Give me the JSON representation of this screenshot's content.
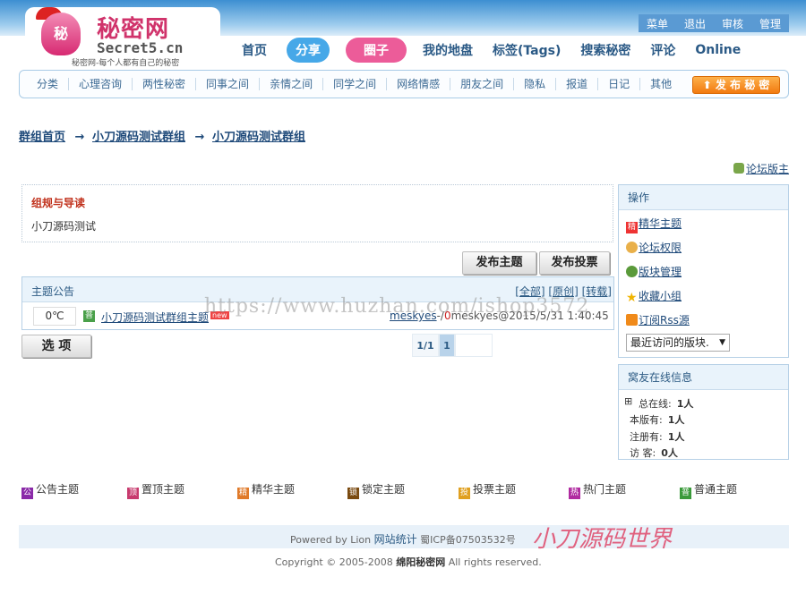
{
  "header": {
    "logo": {
      "badge": "秘",
      "name": "秘密网",
      "domain": "Secret5.cn",
      "slogan": "秘密网-每个人都有自己的秘密"
    },
    "util_links": [
      "菜单",
      "退出",
      "审核",
      "管理"
    ],
    "main_nav": [
      "首页",
      "分享",
      "圈子",
      "我的地盘",
      "标签(Tags)",
      "搜索秘密",
      "评论",
      "Online"
    ],
    "categories": [
      "分类",
      "心理咨询",
      "两性秘密",
      "同事之间",
      "亲情之间",
      "同学之间",
      "网络情感",
      "朋友之间",
      "隐私",
      "报道",
      "日记",
      "其他"
    ],
    "post_secret_label": "发 布 秘 密"
  },
  "breadcrumb": {
    "items": [
      "群组首页",
      "小刀源码测试群组",
      "小刀源码测试群组"
    ],
    "separator": "→"
  },
  "moderator_link": "论坛版主",
  "rules": {
    "title": "组规与导读",
    "body": "小刀源码测试"
  },
  "actions": {
    "new_topic": "发布主题",
    "new_poll": "发布投票",
    "options": "选 项"
  },
  "announcement": {
    "title": "主题公告",
    "links": [
      "[全部]",
      "[原创]",
      "[转载]"
    ],
    "row": {
      "temperature": "0℃",
      "type_badge": "普",
      "subject": "小刀源码测试群组主题",
      "new_badge": "new",
      "author": "meskyes",
      "separator": "-/",
      "last_reply": "0",
      "last_info": "meskyes@2015/5/31 1:40:45"
    }
  },
  "pager": {
    "summary": "1/1",
    "current": "1"
  },
  "watermark": "https://www.huzhan.com/ishop3572",
  "sidebar": {
    "ops_title": "操作",
    "ops": [
      {
        "icon": "精",
        "label": "精华主题"
      },
      {
        "icon": "",
        "label": "论坛权限"
      },
      {
        "icon": "",
        "label": "版块管理"
      },
      {
        "icon": "",
        "label": "收藏小组"
      },
      {
        "icon": "",
        "label": "订阅Rss源"
      }
    ],
    "recent_select": "最近访问的版块.",
    "online_title": "窝友在线信息",
    "online": {
      "expand": "⊞",
      "total_label": "总在线:",
      "total_value": "1人",
      "here_label": "本版有:",
      "here_value": "1人",
      "registered_label": "注册有:",
      "registered_value": "1人",
      "guest_label": "访 客:",
      "guest_value": "0人"
    }
  },
  "legend": [
    {
      "icon": "公",
      "label": "公告主题",
      "color": "#8a2aa8"
    },
    {
      "icon": "顶",
      "label": "置顶主题",
      "color": "#c83a6e"
    },
    {
      "icon": "精",
      "label": "精华主题",
      "color": "#e07a2a"
    },
    {
      "icon": "锁",
      "label": "锁定主题",
      "color": "#7a4a10"
    },
    {
      "icon": "投",
      "label": "投票主题",
      "color": "#e0a020"
    },
    {
      "icon": "热",
      "label": "热门主题",
      "color": "#b02aa0"
    },
    {
      "icon": "普",
      "label": "普通主题",
      "color": "#3a9a3a"
    }
  ],
  "footer": {
    "powered": "Powered by Lion",
    "stat_link": "网站统计",
    "icp": "蜀ICP备07503532号",
    "signature": "小刀源码世界",
    "copyright_prefix": "Copyright © 2005-2008",
    "company": "绵阳秘密网",
    "copyright_suffix": "All rights reserved."
  }
}
